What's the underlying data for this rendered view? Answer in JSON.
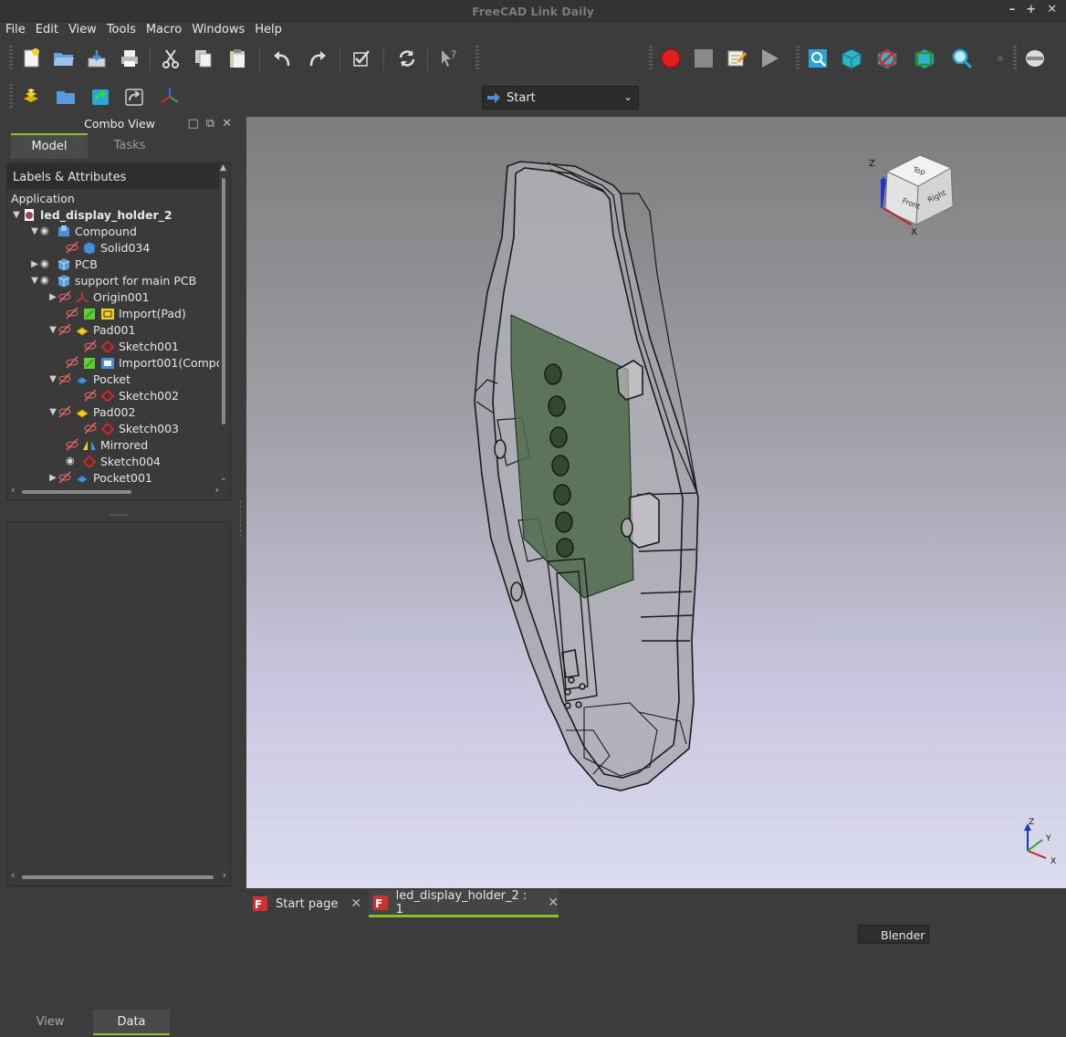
{
  "window": {
    "title": "FreeCAD Link Daily",
    "buttons": [
      "–",
      "+",
      "✕"
    ]
  },
  "menu": [
    "File",
    "Edit",
    "View",
    "Tools",
    "Macro",
    "Windows",
    "Help"
  ],
  "workbench_selector": {
    "value": "Start"
  },
  "combo_view": {
    "title": "Combo View",
    "tabs": [
      "Model",
      "Tasks"
    ],
    "active_tab": "Model",
    "tree_header": "Labels & Attributes",
    "tree_section": "Application",
    "tree": [
      {
        "label": "led_display_holder_2",
        "bold": true
      },
      {
        "label": "Compound"
      },
      {
        "label": "Solid034"
      },
      {
        "label": "PCB"
      },
      {
        "label": "support for main PCB"
      },
      {
        "label": "Origin001"
      },
      {
        "label": "Import(Pad)"
      },
      {
        "label": "Pad001"
      },
      {
        "label": "Sketch001"
      },
      {
        "label": "Import001(Compou"
      },
      {
        "label": "Pocket"
      },
      {
        "label": "Sketch002"
      },
      {
        "label": "Pad002"
      },
      {
        "label": "Sketch003"
      },
      {
        "label": "Mirrored"
      },
      {
        "label": "Sketch004"
      },
      {
        "label": "Pocket001"
      }
    ],
    "splitter": "-----",
    "bottom_tabs": [
      "View",
      "Data"
    ],
    "active_bottom_tab": "Data"
  },
  "navcube": {
    "axis_z": "Z",
    "axis_x": "X",
    "faces": [
      "Top",
      "Front",
      "Right"
    ]
  },
  "axis_indicator": {
    "z": "Z",
    "y": "Y",
    "x": "X"
  },
  "doc_tabs": [
    {
      "label": "Start page",
      "active": false
    },
    {
      "label": "led_display_holder_2 : 1",
      "active": true
    }
  ],
  "status": {
    "navigation_style": "Blender"
  },
  "colors": {
    "accent": "#8dbe2d",
    "record": "#e02020"
  }
}
